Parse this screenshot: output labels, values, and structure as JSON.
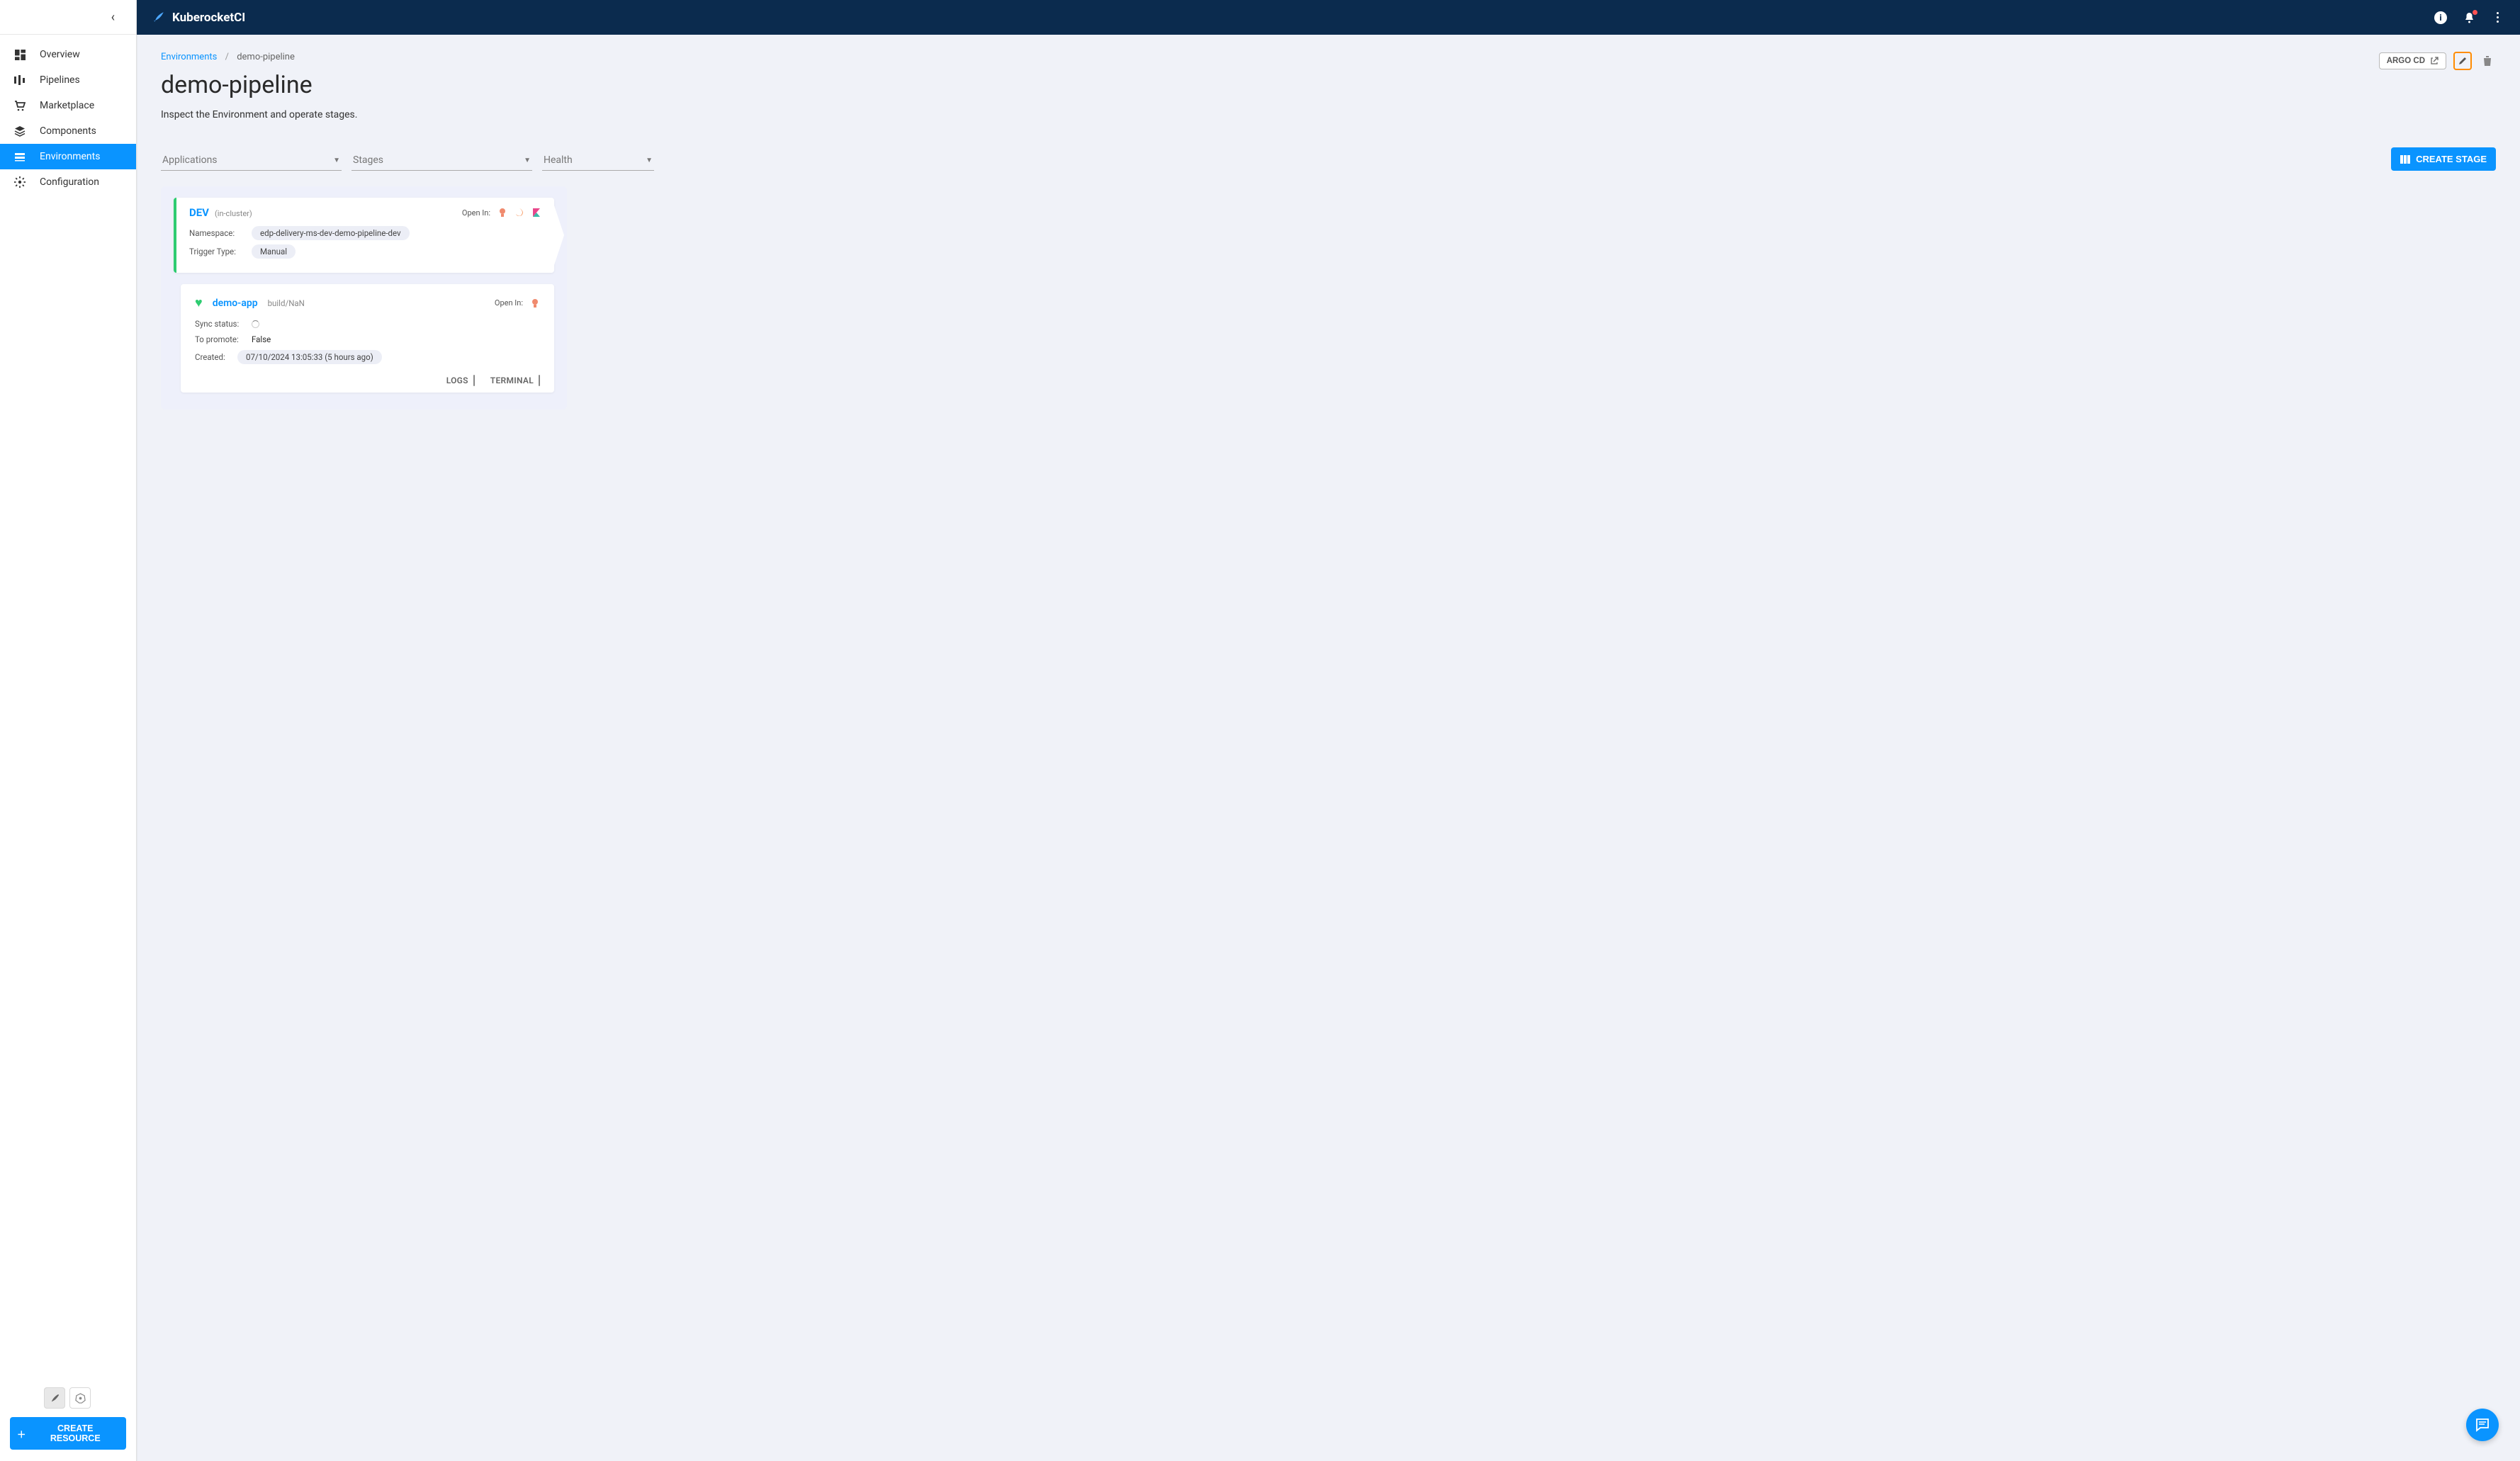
{
  "brand": "KuberocketCI",
  "sidebar": {
    "items": [
      {
        "label": "Overview",
        "icon": "dashboard"
      },
      {
        "label": "Pipelines",
        "icon": "pipeline"
      },
      {
        "label": "Marketplace",
        "icon": "cart"
      },
      {
        "label": "Components",
        "icon": "layers"
      },
      {
        "label": "Environments",
        "icon": "stack",
        "active": true
      },
      {
        "label": "Configuration",
        "icon": "gear"
      }
    ],
    "create_resource_label": "CREATE RESOURCE"
  },
  "breadcrumb": {
    "root": "Environments",
    "current": "demo-pipeline"
  },
  "page": {
    "title": "demo-pipeline",
    "desc": "Inspect the Environment and operate stages."
  },
  "header_actions": {
    "argo_label": "ARGO CD"
  },
  "filters": {
    "applications": "Applications",
    "stages": "Stages",
    "health": "Health"
  },
  "create_stage_label": "CREATE STAGE",
  "stage": {
    "name": "DEV",
    "cluster": "(in-cluster)",
    "open_in_label": "Open In:",
    "namespace_label": "Namespace:",
    "namespace_value": "edp-delivery-ms-dev-demo-pipeline-dev",
    "trigger_label": "Trigger Type:",
    "trigger_value": "Manual"
  },
  "app": {
    "name": "demo-app",
    "build": "build/NaN",
    "open_in_label": "Open In:",
    "sync_label": "Sync status:",
    "promote_label": "To promote:",
    "promote_value": "False",
    "created_label": "Created:",
    "created_value": "07/10/2024 13:05:33 (5 hours ago)",
    "logs_label": "LOGS",
    "terminal_label": "TERMINAL"
  }
}
